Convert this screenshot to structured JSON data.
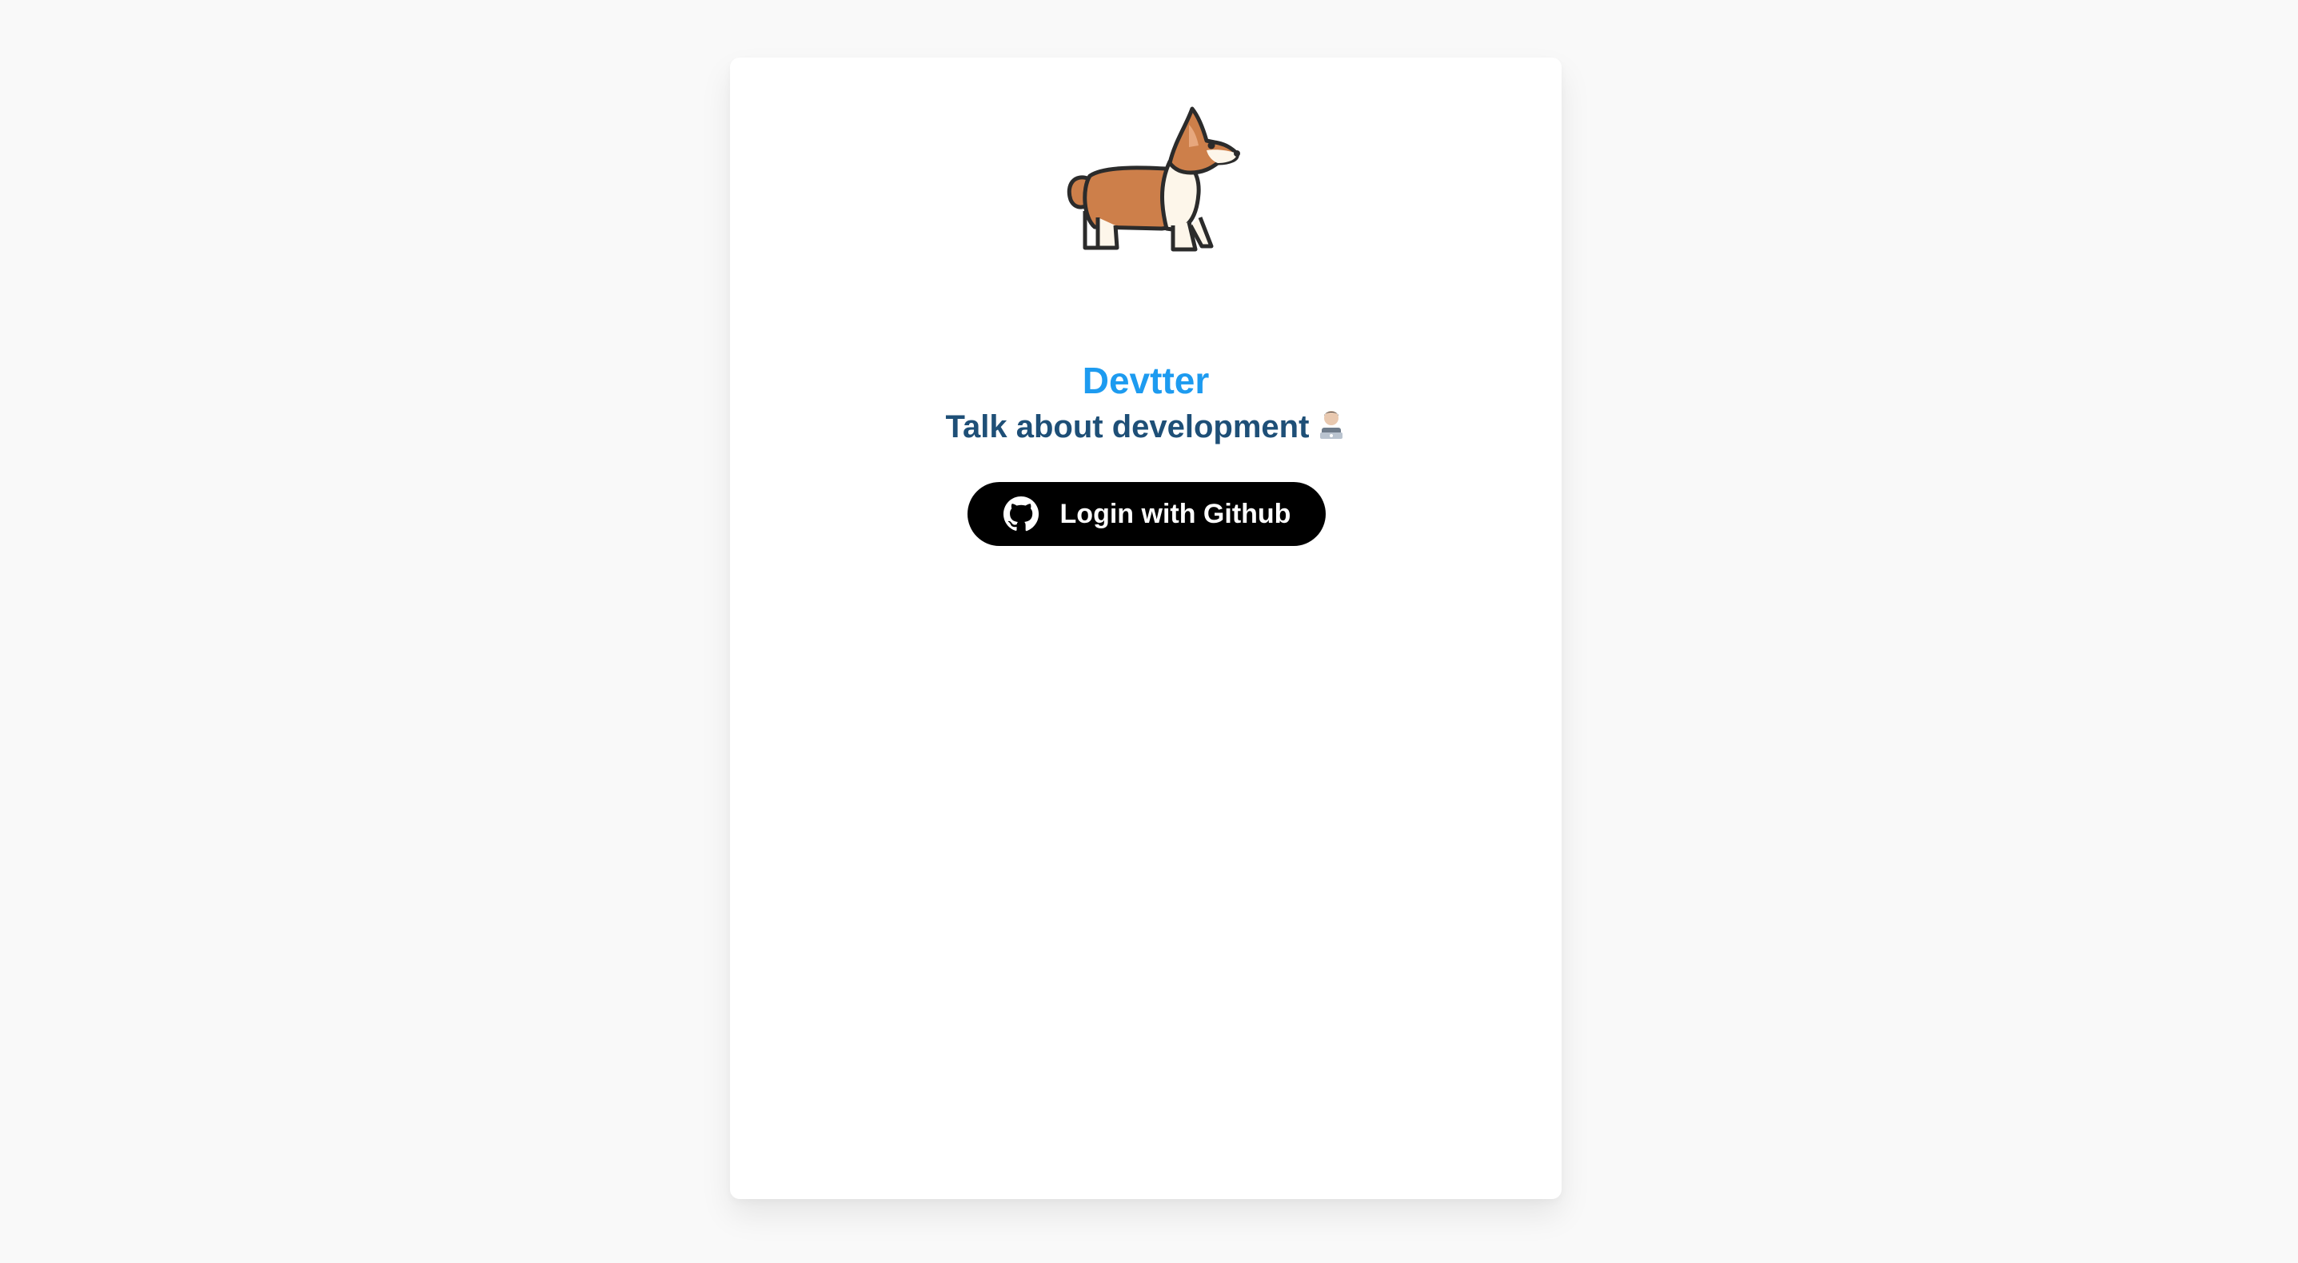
{
  "app": {
    "brand": "Devtter",
    "tagline": "Talk about development"
  },
  "login": {
    "button_label": "Login with Github"
  },
  "icons": {
    "logo": "corgi-logo-icon",
    "tagline_emoji": "technologist-emoji-icon",
    "login": "github-icon"
  },
  "colors": {
    "background": "#f9f9f9",
    "card": "#ffffff",
    "brand": "#1d9bf0",
    "tagline": "#1e4f77",
    "button_bg": "#000000",
    "button_text": "#ffffff"
  }
}
